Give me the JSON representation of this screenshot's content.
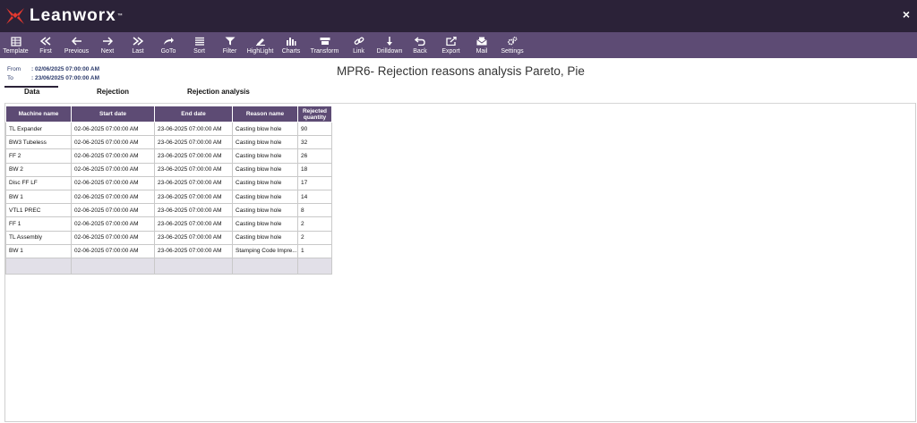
{
  "app": {
    "brand_name": "Leanworx",
    "brand_tm": "™",
    "close_glyph": "×",
    "brand_color": "#e5392f",
    "topbar_color": "#2b2238",
    "toolbar_color": "#5d4b74"
  },
  "toolbar": {
    "items": [
      {
        "label": "Template",
        "icon": "template-icon"
      },
      {
        "label": "First",
        "icon": "first-icon"
      },
      {
        "label": "Previous",
        "icon": "previous-icon"
      },
      {
        "label": "Next",
        "icon": "next-icon"
      },
      {
        "label": "Last",
        "icon": "last-icon"
      },
      {
        "label": "GoTo",
        "icon": "goto-icon"
      },
      {
        "label": "Sort",
        "icon": "sort-icon"
      },
      {
        "label": "Filter",
        "icon": "filter-icon"
      },
      {
        "label": "HighLight",
        "icon": "highlight-icon"
      },
      {
        "label": "Charts",
        "icon": "charts-icon"
      },
      {
        "label": "Transform",
        "icon": "transform-icon"
      },
      {
        "label": "Link",
        "icon": "link-icon"
      },
      {
        "label": "Drilldown",
        "icon": "drilldown-icon"
      },
      {
        "label": "Back",
        "icon": "back-icon"
      },
      {
        "label": "Export",
        "icon": "export-icon"
      },
      {
        "label": "Mail",
        "icon": "mail-icon"
      },
      {
        "label": "Settings",
        "icon": "settings-icon"
      }
    ]
  },
  "range": {
    "from_label": "From",
    "from_value": ": 02/06/2025 07:00:00 AM",
    "to_label": "To",
    "to_value": ": 23/06/2025 07:00:00 AM"
  },
  "report": {
    "title": "MPR6- Rejection reasons analysis Pareto, Pie"
  },
  "tabs": [
    {
      "label": "Data",
      "active": true
    },
    {
      "label": "Rejection",
      "active": false
    },
    {
      "label": "Rejection analysis",
      "active": false
    }
  ],
  "table": {
    "columns": [
      "Machine name",
      "Start date",
      "End date",
      "Reason name",
      "Rejected quantity"
    ],
    "rows": [
      [
        "TL Expander",
        "02-06-2025 07:00:00 AM",
        "23-06-2025 07:00:00 AM",
        "Casting blow hole",
        "90"
      ],
      [
        "BW3 Tubeless",
        "02-06-2025 07:00:00 AM",
        "23-06-2025 07:00:00 AM",
        "Casting blow hole",
        "32"
      ],
      [
        "FF 2",
        "02-06-2025 07:00:00 AM",
        "23-06-2025 07:00:00 AM",
        "Casting blow hole",
        "26"
      ],
      [
        "BW 2",
        "02-06-2025 07:00:00 AM",
        "23-06-2025 07:00:00 AM",
        "Casting blow hole",
        "18"
      ],
      [
        "Disc FF LF",
        "02-06-2025 07:00:00 AM",
        "23-06-2025 07:00:00 AM",
        "Casting blow hole",
        "17"
      ],
      [
        "BW 1",
        "02-06-2025 07:00:00 AM",
        "23-06-2025 07:00:00 AM",
        "Casting blow hole",
        "14"
      ],
      [
        "VTL1 PREC",
        "02-06-2025 07:00:00 AM",
        "23-06-2025 07:00:00 AM",
        "Casting blow hole",
        "8"
      ],
      [
        "FF 1",
        "02-06-2025 07:00:00 AM",
        "23-06-2025 07:00:00 AM",
        "Casting blow hole",
        "2"
      ],
      [
        "TL Assembly",
        "02-06-2025 07:00:00 AM",
        "23-06-2025 07:00:00 AM",
        "Casting blow hole",
        "2"
      ],
      [
        "BW 1",
        "02-06-2025 07:00:00 AM",
        "23-06-2025 07:00:00 AM",
        "Stamping Code Impre...",
        "1"
      ]
    ]
  }
}
